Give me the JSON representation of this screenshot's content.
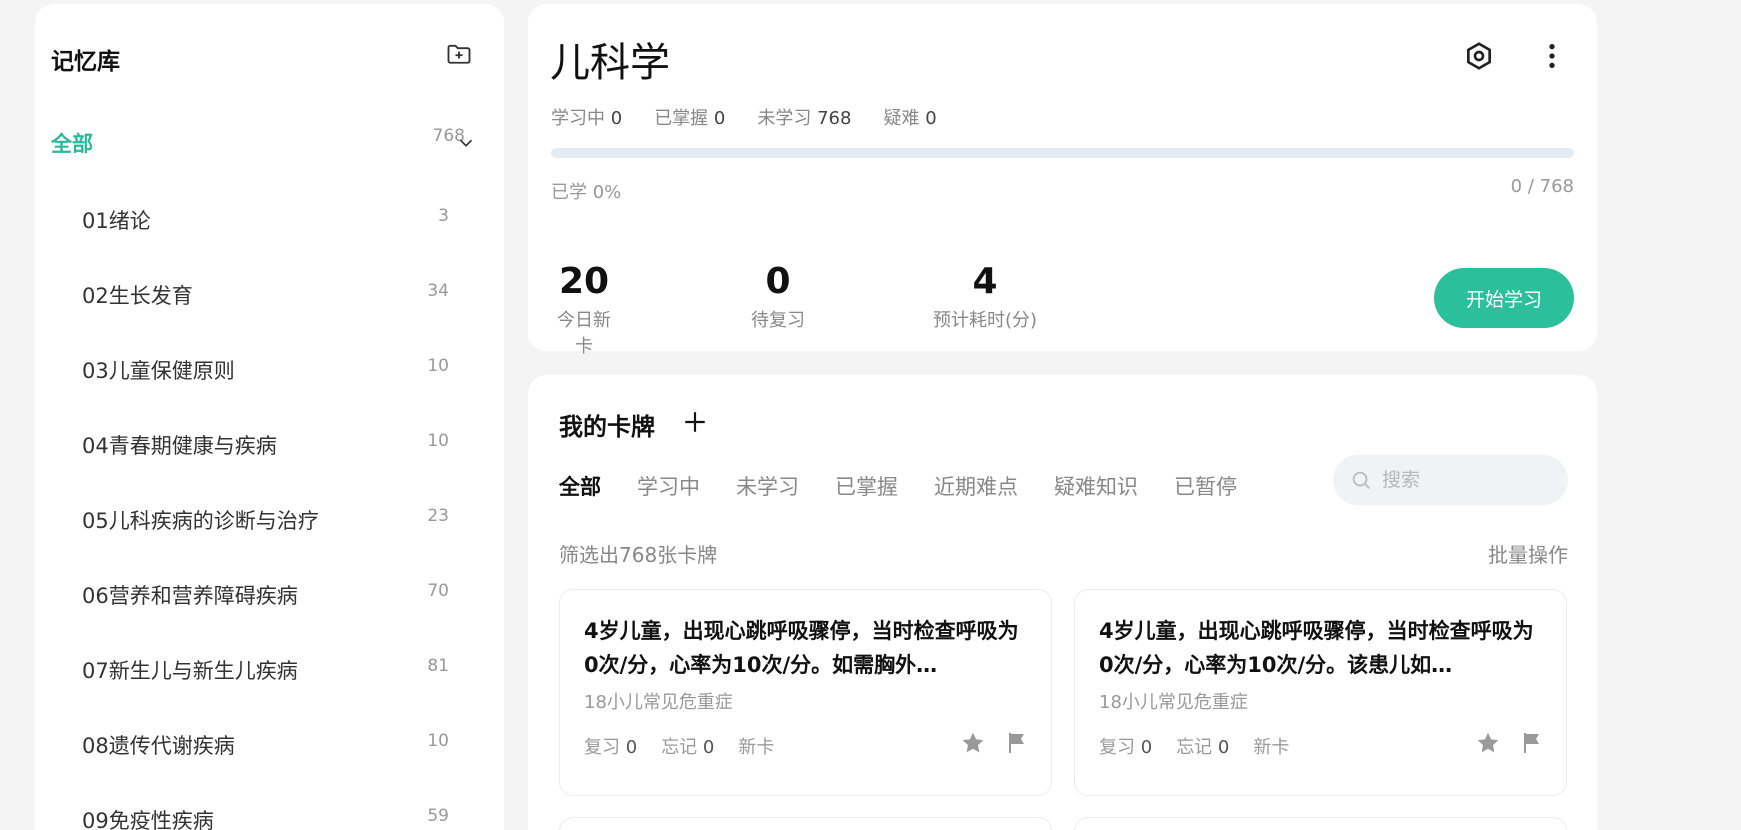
{
  "sidebar": {
    "title": "记忆库",
    "all": {
      "label": "全部",
      "count": "768"
    },
    "items": [
      {
        "label": "01绪论",
        "count": "3"
      },
      {
        "label": "02生长发育",
        "count": "34"
      },
      {
        "label": "03儿童保健原则",
        "count": "10"
      },
      {
        "label": "04青春期健康与疾病",
        "count": "10"
      },
      {
        "label": "05儿科疾病的诊断与治疗",
        "count": "23"
      },
      {
        "label": "06营养和营养障碍疾病",
        "count": "70"
      },
      {
        "label": "07新生儿与新生儿疾病",
        "count": "81"
      },
      {
        "label": "08遗传代谢疾病",
        "count": "10"
      },
      {
        "label": "09免疫性疾病",
        "count": "59"
      }
    ]
  },
  "deck": {
    "title": "儿科学",
    "stats": {
      "learning_label": "学习中",
      "learning": "0",
      "mastered_label": "已掌握",
      "mastered": "0",
      "unlearned_label": "未学习",
      "unlearned": "768",
      "difficult_label": "疑难",
      "difficult": "0"
    },
    "progress_label": "已学 0%",
    "progress_count": "0 / 768",
    "progress_fraction": 0,
    "metrics": {
      "new_today": "20",
      "new_today_label": "今日新卡",
      "review": "0",
      "review_label": "待复习",
      "est_time": "4",
      "est_time_label": "预计耗时(分)"
    },
    "start_button": "开始学习"
  },
  "cards_panel": {
    "title": "我的卡牌",
    "tabs": [
      "全部",
      "学习中",
      "未学习",
      "已掌握",
      "近期难点",
      "疑难知识",
      "已暂停"
    ],
    "active_tab": "全部",
    "search_placeholder": "搜索",
    "filter_text": "筛选出768张卡牌",
    "batch_label": "批量操作",
    "cards": [
      {
        "question": "4岁儿童，出现心跳呼吸骤停，当时检查呼吸为0次/分，心率为10次/分。如需胸外…",
        "tag": "18小儿常见危重症",
        "review_label": "复习",
        "review": "0",
        "forget_label": "忘记",
        "forget": "0",
        "status": "新卡"
      },
      {
        "question": "4岁儿童，出现心跳呼吸骤停，当时检查呼吸为0次/分，心率为10次/分。该患儿如…",
        "tag": "18小儿常见危重症",
        "review_label": "复习",
        "review": "0",
        "forget_label": "忘记",
        "forget": "0",
        "status": "新卡"
      }
    ]
  },
  "colors": {
    "accent": "#2bb99a",
    "button": "#2bbf9b",
    "progress_track": "#e6ebf2"
  }
}
